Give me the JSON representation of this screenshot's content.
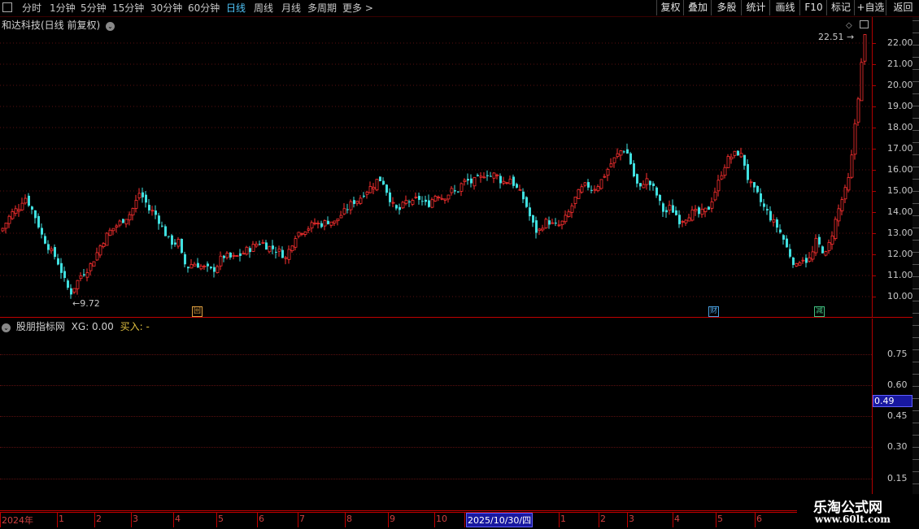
{
  "toolbar": {
    "timeframes": [
      "分时",
      "1分钟",
      "5分钟",
      "15分钟",
      "30分钟",
      "60分钟",
      "日线",
      "周线",
      "月线",
      "多周期",
      "更多 >"
    ],
    "active_index": 6,
    "buttons": [
      "复权",
      "叠加",
      "多股",
      "统计",
      "画线",
      "F10",
      "标记",
      "+自选",
      "返回"
    ]
  },
  "main": {
    "title": "和达科技(日线 前复权)",
    "high_label": "22.51",
    "low_label": "9.72",
    "badges": [
      {
        "text": "回",
        "color": "#e0a040"
      },
      {
        "text": "财",
        "color": "#4aa0e0"
      },
      {
        "text": "减",
        "color": "#40c080"
      }
    ]
  },
  "indicator": {
    "title": "股朋指标网",
    "xg_text": "XG: 0.00",
    "buy_text": "买入: -",
    "current_value": "0.49"
  },
  "dates": {
    "labels": [
      "2024年",
      "1",
      "2",
      "3",
      "4",
      "5",
      "6",
      "7",
      "8",
      "9",
      "10",
      "2025/10/30/四",
      "1",
      "2",
      "3",
      "4",
      "5",
      "6"
    ]
  },
  "watermark": {
    "line1": "乐淘公式网",
    "line2": "www.60lt.com"
  },
  "chart_data": {
    "type": "candlestick",
    "y_axis_labels": [
      "22.00",
      "21.00",
      "20.00",
      "19.00",
      "18.00",
      "17.00",
      "16.00",
      "15.00",
      "14.00",
      "13.00",
      "12.00",
      "11.00",
      "10.00"
    ],
    "indicator_axis_labels": [
      "0.75",
      "0.60",
      "0.45",
      "0.30",
      "0.15"
    ],
    "ylim": [
      9.5,
      22.8
    ],
    "up_color": "#ff3030",
    "down_color": "#40e0e0",
    "close_path": [
      [
        0,
        13.1
      ],
      [
        6,
        13.5
      ],
      [
        12,
        13.9
      ],
      [
        18,
        14.1
      ],
      [
        24,
        14.3
      ],
      [
        28,
        14.8
      ],
      [
        33,
        14.5
      ],
      [
        38,
        14.1
      ],
      [
        44,
        13.6
      ],
      [
        50,
        12.9
      ],
      [
        56,
        12.5
      ],
      [
        62,
        12.1
      ],
      [
        68,
        11.8
      ],
      [
        74,
        11.2
      ],
      [
        80,
        10.5
      ],
      [
        86,
        10.2
      ],
      [
        92,
        10.6
      ],
      [
        98,
        11.0
      ],
      [
        104,
        11.2
      ],
      [
        110,
        11.5
      ],
      [
        116,
        11.9
      ],
      [
        122,
        12.4
      ],
      [
        128,
        12.8
      ],
      [
        134,
        13.1
      ],
      [
        140,
        13.3
      ],
      [
        146,
        13.5
      ],
      [
        152,
        13.7
      ],
      [
        158,
        13.9
      ],
      [
        164,
        14.3
      ],
      [
        170,
        14.9
      ],
      [
        176,
        14.6
      ],
      [
        182,
        14.1
      ],
      [
        188,
        14.0
      ],
      [
        194,
        13.6
      ],
      [
        200,
        13.1
      ],
      [
        206,
        12.7
      ],
      [
        212,
        12.5
      ],
      [
        218,
        12.6
      ],
      [
        224,
        11.6
      ],
      [
        230,
        11.4
      ],
      [
        236,
        11.6
      ],
      [
        242,
        11.5
      ],
      [
        248,
        11.4
      ],
      [
        254,
        11.3
      ],
      [
        260,
        11.2
      ],
      [
        266,
        11.5
      ],
      [
        272,
        11.9
      ],
      [
        278,
        11.9
      ],
      [
        284,
        11.8
      ],
      [
        290,
        11.9
      ],
      [
        296,
        12.0
      ],
      [
        302,
        12.2
      ],
      [
        308,
        12.3
      ],
      [
        314,
        12.5
      ],
      [
        320,
        12.6
      ],
      [
        326,
        12.4
      ],
      [
        332,
        12.3
      ],
      [
        338,
        12.2
      ],
      [
        344,
        12.1
      ],
      [
        350,
        11.8
      ],
      [
        356,
        12.4
      ],
      [
        362,
        12.9
      ],
      [
        368,
        13.1
      ],
      [
        374,
        13.2
      ],
      [
        380,
        13.3
      ],
      [
        386,
        13.5
      ],
      [
        392,
        13.4
      ],
      [
        398,
        13.5
      ],
      [
        404,
        13.6
      ],
      [
        410,
        13.5
      ],
      [
        416,
        13.8
      ],
      [
        422,
        14.0
      ],
      [
        428,
        14.3
      ],
      [
        434,
        14.5
      ],
      [
        440,
        14.6
      ],
      [
        446,
        14.9
      ],
      [
        452,
        15.1
      ],
      [
        458,
        15.3
      ],
      [
        464,
        15.6
      ],
      [
        470,
        15.4
      ],
      [
        476,
        14.8
      ],
      [
        482,
        14.3
      ],
      [
        488,
        14.0
      ],
      [
        494,
        14.3
      ],
      [
        500,
        14.6
      ],
      [
        506,
        14.4
      ],
      [
        512,
        14.7
      ],
      [
        518,
        14.5
      ],
      [
        524,
        14.3
      ],
      [
        530,
        14.6
      ],
      [
        536,
        14.9
      ],
      [
        542,
        14.7
      ],
      [
        548,
        14.8
      ],
      [
        554,
        15.0
      ],
      [
        560,
        14.9
      ],
      [
        566,
        15.3
      ],
      [
        572,
        15.5
      ],
      [
        578,
        15.4
      ],
      [
        584,
        15.5
      ],
      [
        590,
        15.6
      ],
      [
        596,
        15.9
      ],
      [
        602,
        15.7
      ],
      [
        608,
        15.8
      ],
      [
        614,
        15.5
      ],
      [
        620,
        15.4
      ],
      [
        626,
        15.6
      ],
      [
        632,
        15.2
      ],
      [
        638,
        14.9
      ],
      [
        644,
        14.5
      ],
      [
        650,
        13.8
      ],
      [
        656,
        13.2
      ],
      [
        660,
        13.0
      ],
      [
        666,
        13.4
      ],
      [
        672,
        13.6
      ],
      [
        678,
        13.4
      ],
      [
        684,
        13.3
      ],
      [
        690,
        13.5
      ],
      [
        696,
        13.8
      ],
      [
        702,
        14.3
      ],
      [
        708,
        14.8
      ],
      [
        714,
        15.1
      ],
      [
        720,
        15.3
      ],
      [
        726,
        15.1
      ],
      [
        732,
        15.2
      ],
      [
        738,
        15.5
      ],
      [
        744,
        15.9
      ],
      [
        750,
        16.3
      ],
      [
        756,
        16.6
      ],
      [
        762,
        16.9
      ],
      [
        768,
        17.0
      ],
      [
        774,
        16.3
      ],
      [
        780,
        15.4
      ],
      [
        786,
        15.1
      ],
      [
        792,
        15.6
      ],
      [
        798,
        15.3
      ],
      [
        804,
        15.0
      ],
      [
        810,
        14.4
      ],
      [
        816,
        13.9
      ],
      [
        822,
        14.2
      ],
      [
        828,
        14.0
      ],
      [
        834,
        13.6
      ],
      [
        840,
        13.7
      ],
      [
        846,
        13.9
      ],
      [
        852,
        14.0
      ],
      [
        858,
        13.9
      ],
      [
        864,
        14.0
      ],
      [
        870,
        14.2
      ],
      [
        876,
        14.8
      ],
      [
        882,
        15.4
      ],
      [
        888,
        16.1
      ],
      [
        894,
        16.5
      ],
      [
        900,
        16.7
      ],
      [
        906,
        16.8
      ],
      [
        912,
        16.6
      ],
      [
        918,
        15.6
      ],
      [
        924,
        15.1
      ],
      [
        930,
        14.8
      ],
      [
        936,
        14.3
      ],
      [
        942,
        14.0
      ],
      [
        948,
        13.6
      ],
      [
        954,
        13.3
      ],
      [
        960,
        12.9
      ],
      [
        966,
        12.3
      ],
      [
        972,
        11.8
      ],
      [
        978,
        11.4
      ],
      [
        984,
        11.9
      ],
      [
        990,
        11.7
      ],
      [
        996,
        11.8
      ],
      [
        1002,
        12.6
      ],
      [
        1008,
        12.3
      ],
      [
        1014,
        12.0
      ],
      [
        1020,
        12.7
      ],
      [
        1026,
        13.6
      ],
      [
        1032,
        14.4
      ],
      [
        1038,
        15.0
      ],
      [
        1044,
        15.8
      ],
      [
        1050,
        18.2
      ],
      [
        1054,
        19.5
      ],
      [
        1058,
        21.0
      ],
      [
        1062,
        22.3
      ]
    ]
  }
}
